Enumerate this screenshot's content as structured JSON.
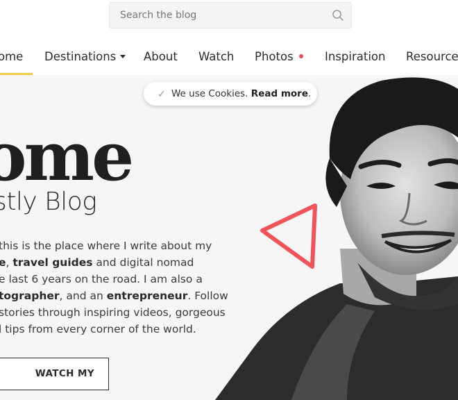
{
  "search": {
    "placeholder": "Search the blog"
  },
  "nav": {
    "items": [
      {
        "label": "ome"
      },
      {
        "label": "Destinations"
      },
      {
        "label": "About"
      },
      {
        "label": "Watch"
      },
      {
        "label": "Photos"
      },
      {
        "label": "Inspiration"
      },
      {
        "label": "Resources"
      }
    ]
  },
  "cookie": {
    "message": "We use Cookies.",
    "link": "Read more",
    "suffix": "."
  },
  "hero": {
    "title": "come",
    "subtitle": "Listly Blog",
    "lines": [
      {
        "a": "this is the place where I write about my",
        "b": "",
        "c": "",
        "d": "",
        "e": ""
      },
      {
        "a": "",
        "b": "e",
        "c": ", ",
        "d": "travel guides",
        "e": " and digital nomad"
      },
      {
        "a": "e last 6 years on the road. I am also a",
        "b": "",
        "c": "",
        "d": "",
        "e": ""
      },
      {
        "a": "",
        "b": "tographer",
        "c": ", and an ",
        "d": "entrepreneur",
        "e": ". Follow"
      },
      {
        "a": "stories through inspiring videos, gorgeous",
        "b": "",
        "c": "",
        "d": "",
        "e": ""
      },
      {
        "a": "l tips from every corner of the world.",
        "b": "",
        "c": "",
        "d": "",
        "e": ""
      }
    ],
    "button": "WATCH MY VIDEOS"
  },
  "colors": {
    "accent_underline": "#f2c94c",
    "dot": "#ee4b50",
    "triangle": "#f0545a"
  }
}
